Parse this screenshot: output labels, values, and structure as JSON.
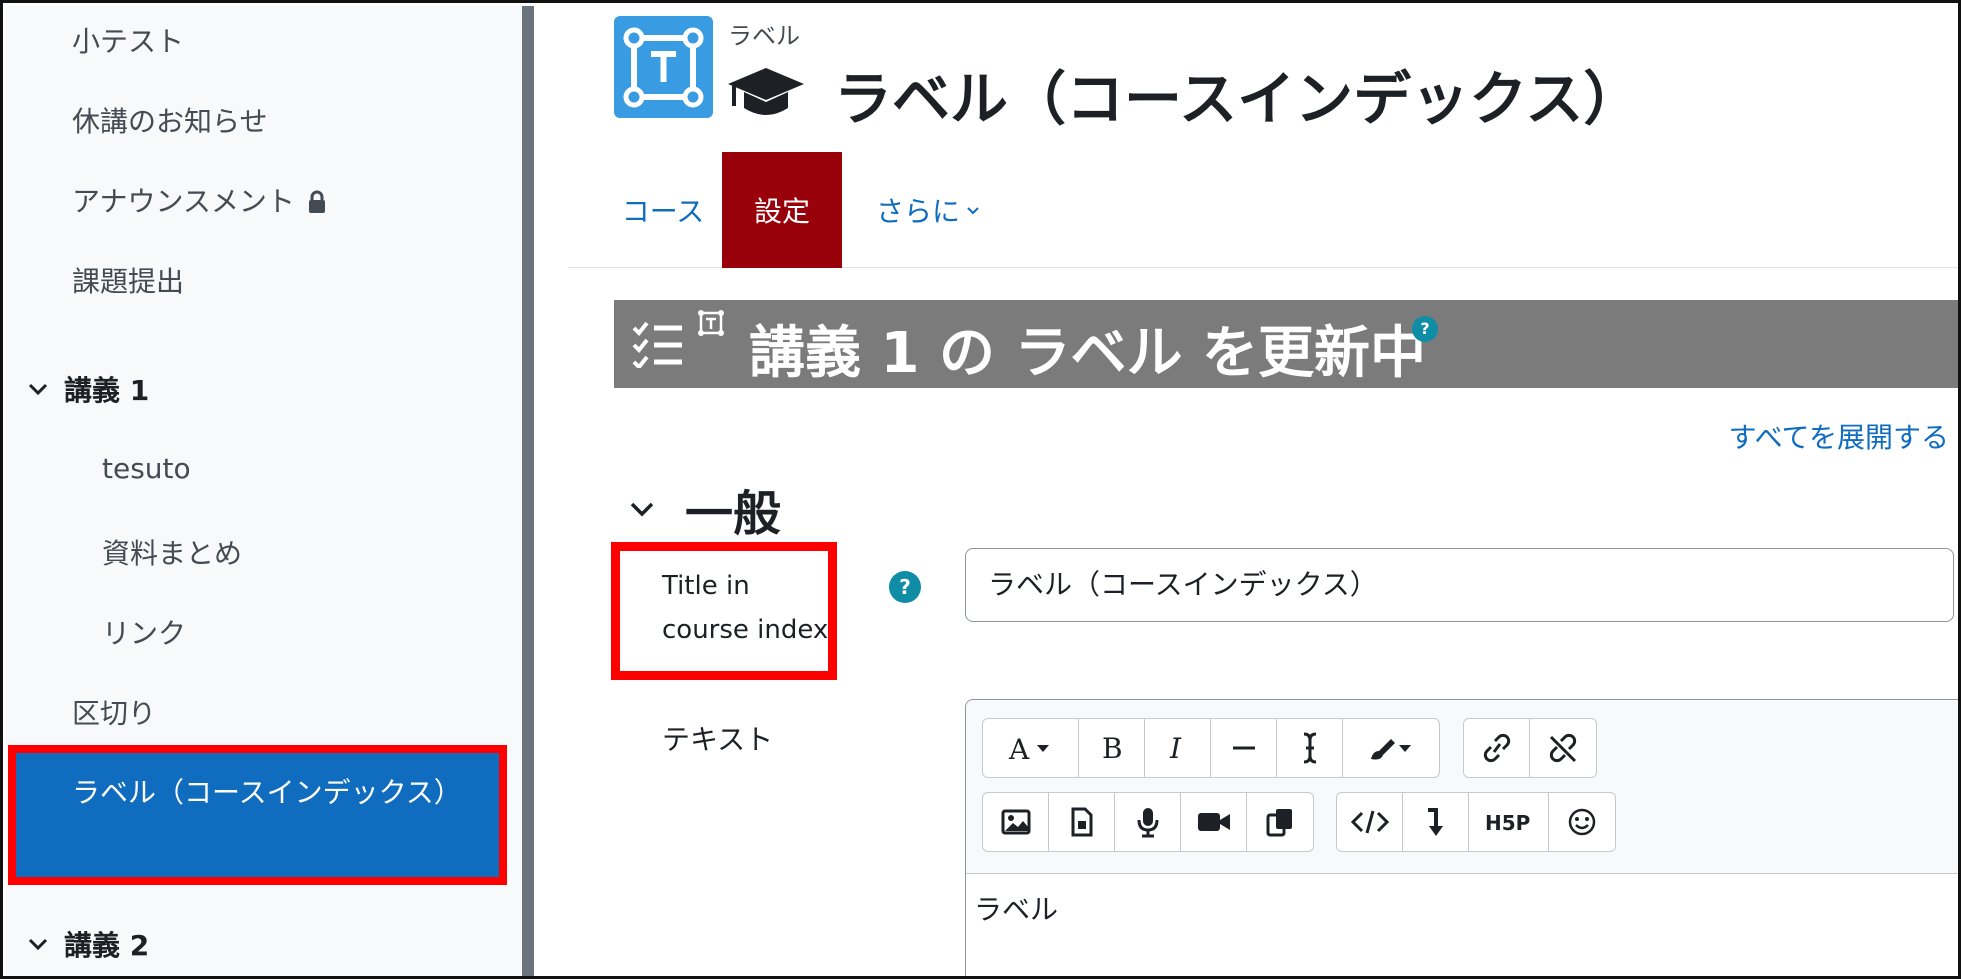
{
  "sidebar": {
    "items": [
      {
        "label": "小テスト"
      },
      {
        "label": "休講のお知らせ"
      },
      {
        "label": "アナウンスメント"
      },
      {
        "label": "課題提出"
      }
    ],
    "section1": {
      "label": "講義 1"
    },
    "section1_items": [
      {
        "label": "tesuto"
      },
      {
        "label": "資料まとめ"
      },
      {
        "label": "リンク"
      }
    ],
    "divider_item": {
      "label": "区切り"
    },
    "active_item": {
      "label": "ラベル（コースインデックス）"
    },
    "section2": {
      "label": "講義 2"
    }
  },
  "header": {
    "kind": "ラベル",
    "title": "ラベル（コースインデックス）",
    "icon_color": "#399be2"
  },
  "tabs": {
    "course": "コース",
    "settings": "設定",
    "more": "さらに"
  },
  "edit_bar": {
    "title": "講義 1 の ラベル を更新中",
    "help": "?"
  },
  "expand_all": "すべてを展開する",
  "section_general": {
    "label": "一般"
  },
  "form": {
    "title_label": "Title in course index",
    "title_value": "ラベル（コースインデックス）",
    "help": "?",
    "text_label": "テキスト",
    "editor_content": "ラベル"
  },
  "colors": {
    "accent": "#0f6cbf",
    "active_tab": "#98010a",
    "highlight": "#ff0000",
    "help": "#0f8da6"
  }
}
